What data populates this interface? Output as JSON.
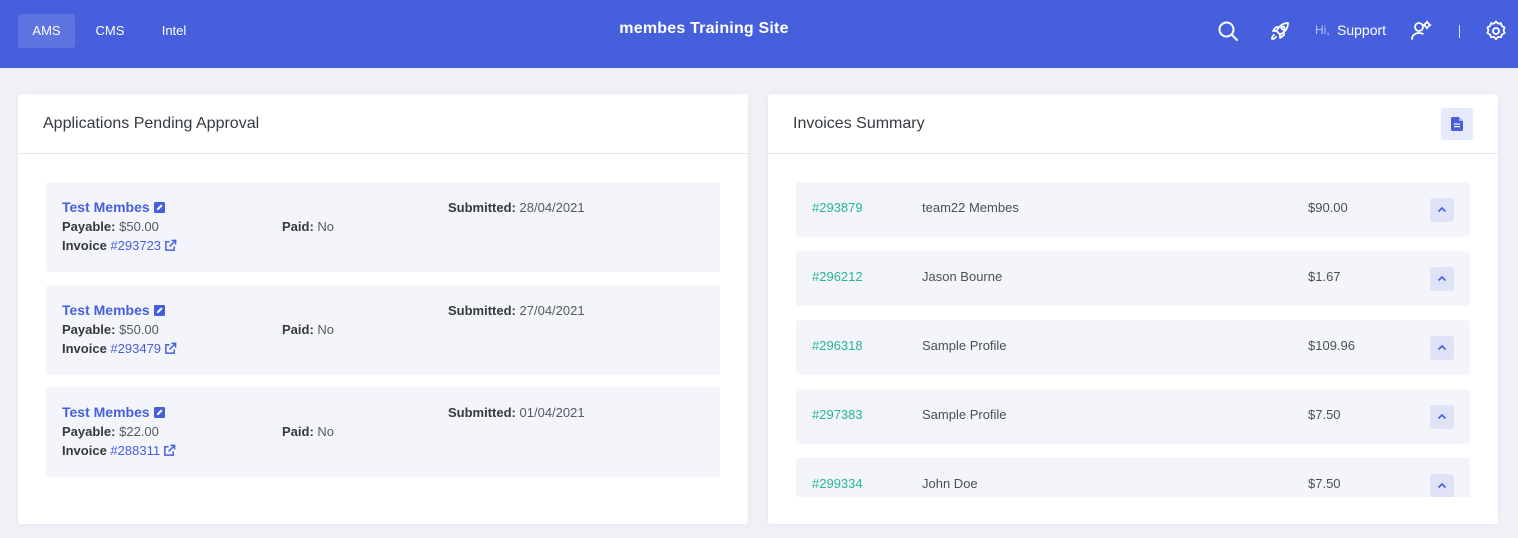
{
  "header": {
    "tabs": [
      {
        "label": "AMS",
        "active": true
      },
      {
        "label": "CMS",
        "active": false
      },
      {
        "label": "Intel",
        "active": false
      }
    ],
    "site_title": "membes Training Site",
    "greeting": "Hi,",
    "user_name": "Support",
    "icons": [
      "search-icon",
      "rocket-icon",
      "user-settings-icon",
      "gear-icon"
    ],
    "bar_color": "#4660dd"
  },
  "applications": {
    "title": "Applications Pending Approval",
    "labels": {
      "payable": "Payable:",
      "paid": "Paid:",
      "invoice": "Invoice",
      "submitted": "Submitted:"
    },
    "items": [
      {
        "name": "Test Membes",
        "payable": "$50.00",
        "paid": "No",
        "invoice": "#293723",
        "submitted": "28/04/2021"
      },
      {
        "name": "Test Membes",
        "payable": "$50.00",
        "paid": "No",
        "invoice": "#293479",
        "submitted": "27/04/2021"
      },
      {
        "name": "Test Membes",
        "payable": "$22.00",
        "paid": "No",
        "invoice": "#288311",
        "submitted": "01/04/2021"
      }
    ]
  },
  "invoices": {
    "title": "Invoices Summary",
    "export_icon": "document-icon",
    "items": [
      {
        "number": "#293879",
        "name": "team22 Membes",
        "amount": "$90.00"
      },
      {
        "number": "#296212",
        "name": "Jason Bourne",
        "amount": "$1.67"
      },
      {
        "number": "#296318",
        "name": "Sample Profile",
        "amount": "$109.96"
      },
      {
        "number": "#297383",
        "name": "Sample Profile",
        "amount": "$7.50"
      },
      {
        "number": "#299334",
        "name": "John Doe",
        "amount": "$7.50"
      }
    ],
    "number_color": "#25b59a"
  }
}
